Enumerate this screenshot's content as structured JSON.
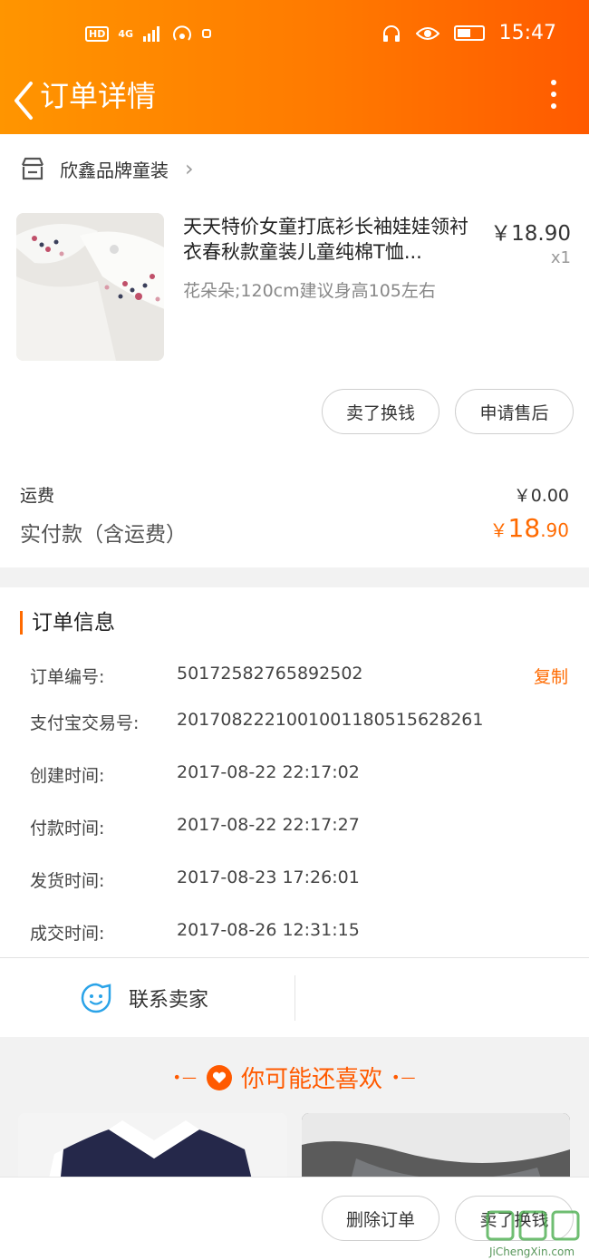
{
  "status_bar": {
    "hd": "HD",
    "network": "4G",
    "time": "15:47"
  },
  "nav": {
    "title": "订单详情"
  },
  "shop": {
    "name": "欣鑫品牌童装"
  },
  "product": {
    "title": "天天特价女童打底衫长袖娃娃领衬衣春秋款童装儿童纯棉T恤...",
    "spec": "花朵朵;120cm建议身高105左右",
    "price": "￥18.90",
    "qty": "x1"
  },
  "actions": {
    "sell": "卖了换钱",
    "after_sale": "申请售后"
  },
  "fees": {
    "shipping_label": "运费",
    "shipping_value": "￥0.00",
    "paid_label": "实付款（含运费）",
    "paid_currency": "￥",
    "paid_int": "18",
    "paid_dec": ".90"
  },
  "order_info": {
    "title": "订单信息",
    "copy_label": "复制",
    "rows": [
      {
        "key": "订单编号:",
        "value": "50172582765892502"
      },
      {
        "key": "支付宝交易号:",
        "value": "2017082221001001180515628261"
      },
      {
        "key": "创建时间:",
        "value": "2017-08-22 22:17:02"
      },
      {
        "key": "付款时间:",
        "value": "2017-08-22 22:17:27"
      },
      {
        "key": "发货时间:",
        "value": "2017-08-23 17:26:01"
      },
      {
        "key": "成交时间:",
        "value": "2017-08-26 12:31:15"
      }
    ]
  },
  "contact": {
    "label": "联系卖家"
  },
  "recommend": {
    "title": "你可能还喜欢"
  },
  "bottom": {
    "delete": "删除订单",
    "sell": "卖了换钱"
  },
  "watermark": {
    "text": "JiChengXin.com"
  },
  "colors": {
    "accent": "#ff6a00",
    "header_start": "#ff9500",
    "header_end": "#ff5a00"
  }
}
